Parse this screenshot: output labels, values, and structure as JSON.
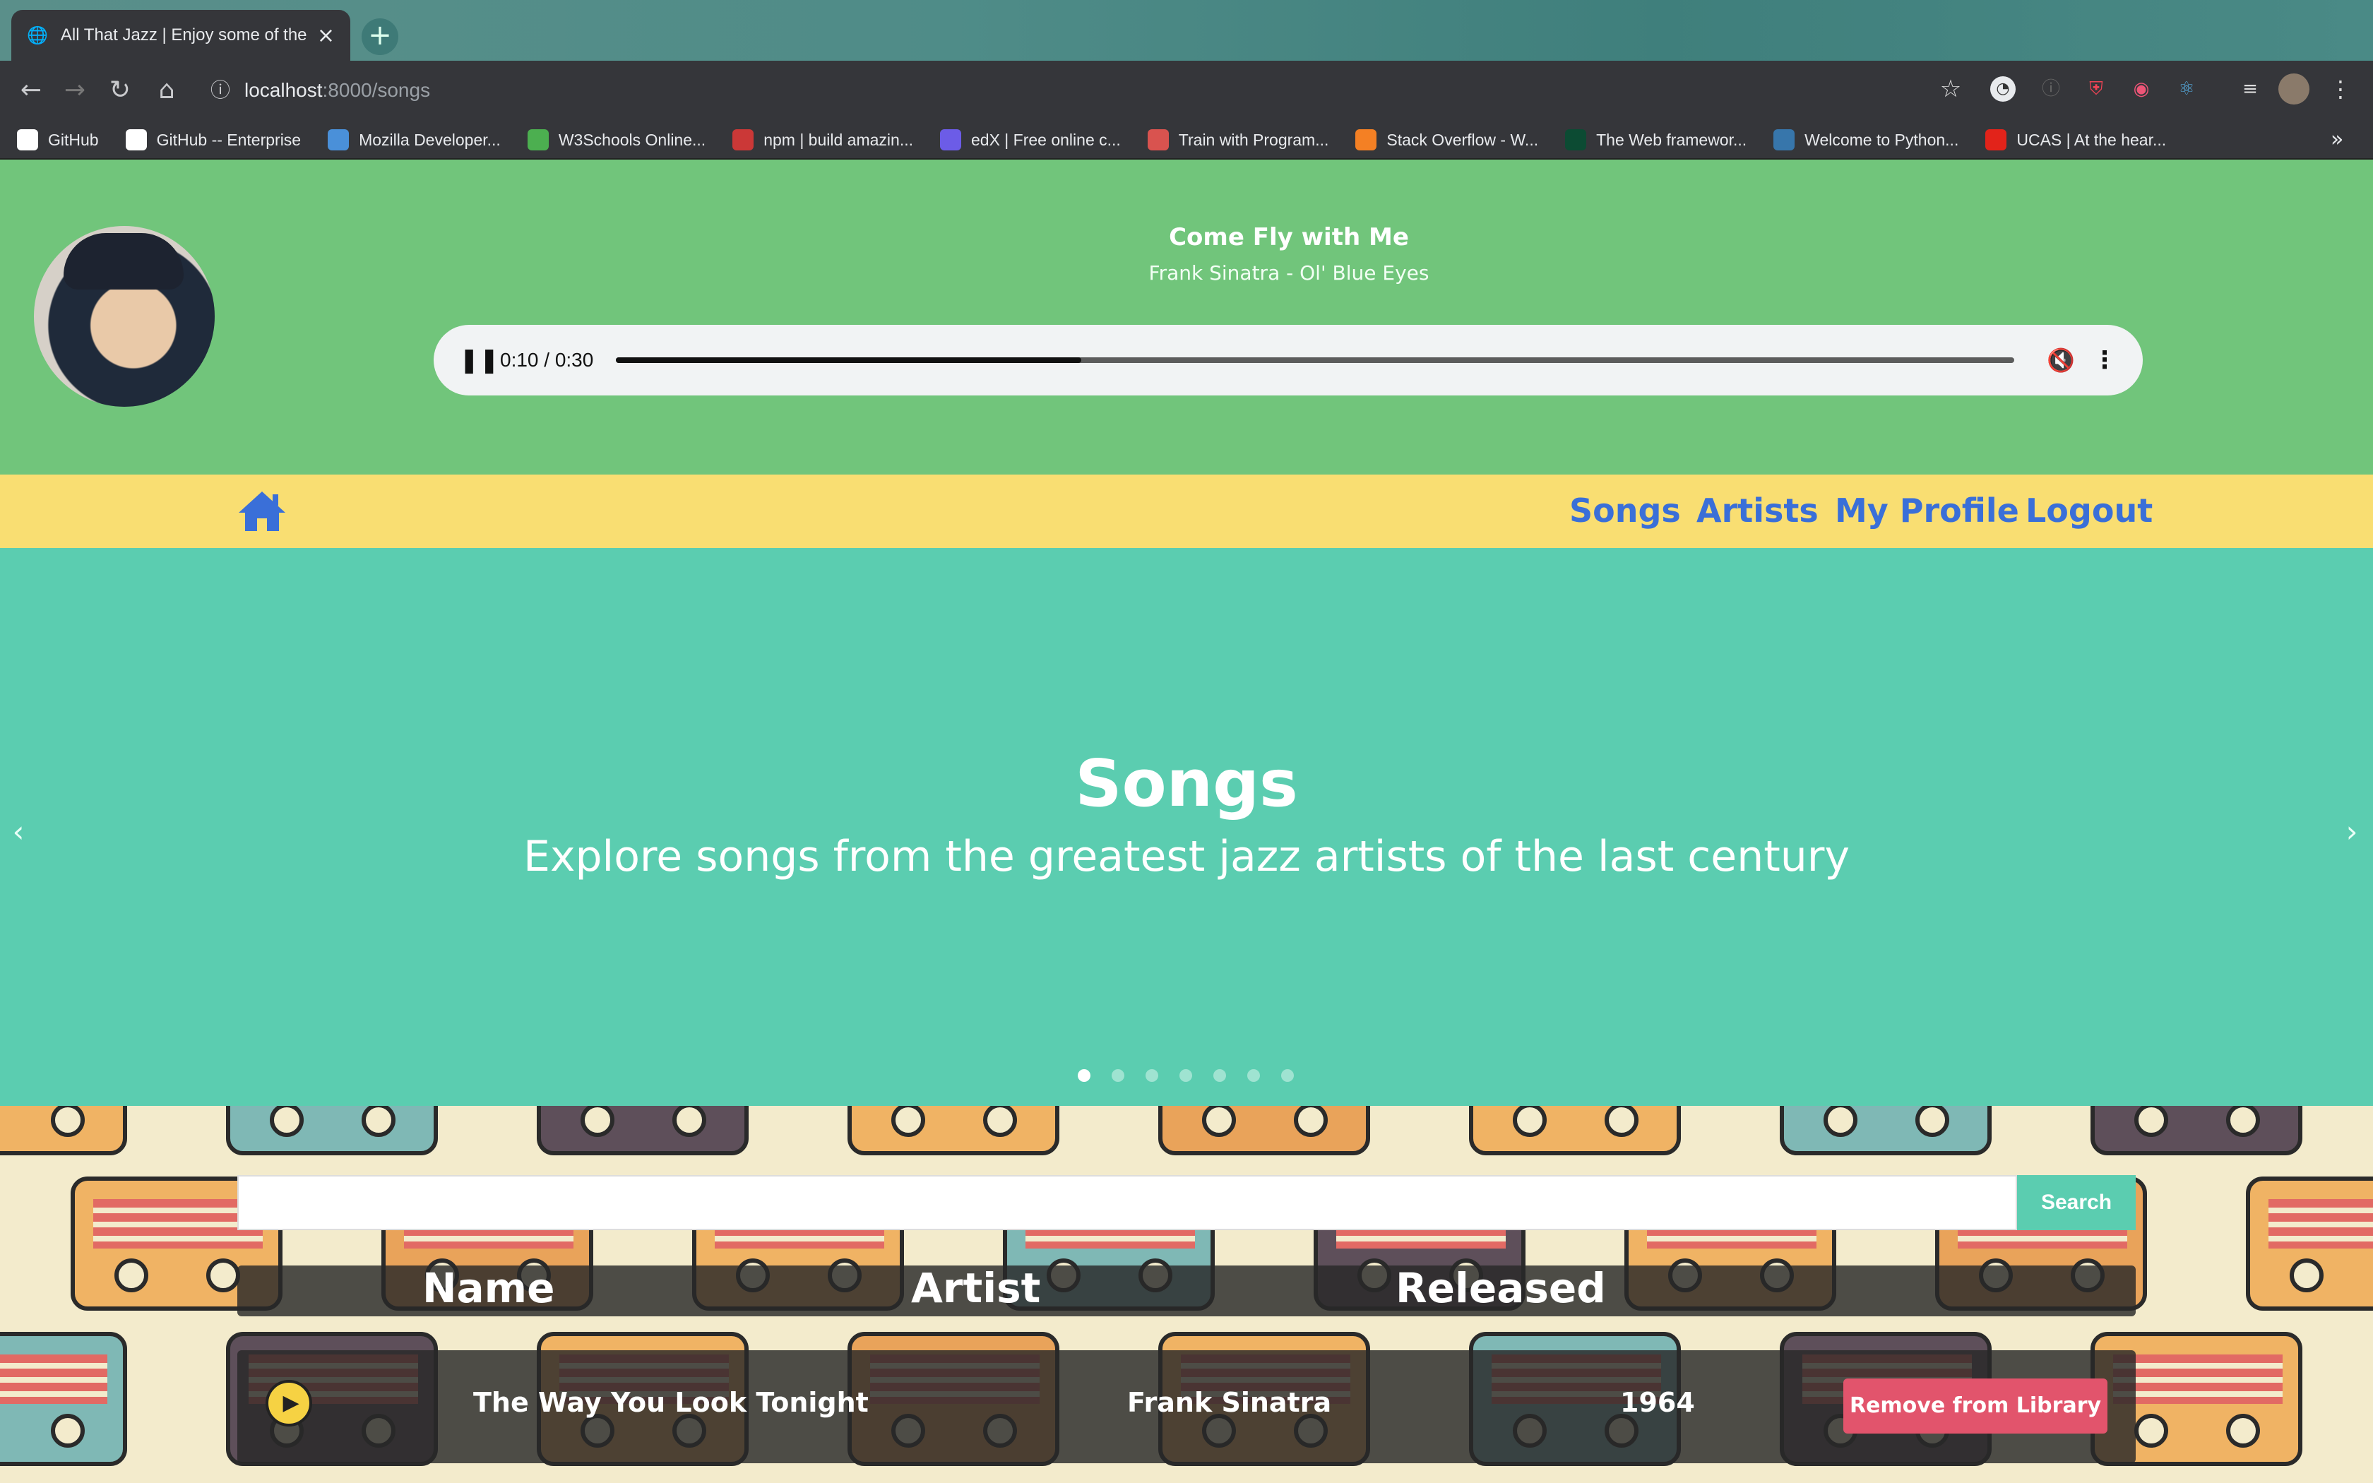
{
  "browser": {
    "tab_title": "All That Jazz | Enjoy some of the",
    "tab_close": "×",
    "new_tab": "+",
    "url_host": "localhost",
    "url_path": ":8000/songs",
    "bookmarks": [
      {
        "label": "GitHub",
        "icon": "github-icon",
        "color": "#ffffff"
      },
      {
        "label": "GitHub -- Enterprise",
        "icon": "github-icon",
        "color": "#ffffff"
      },
      {
        "label": "Mozilla Developer...",
        "icon": "mdn-icon",
        "color": "#4a90d9"
      },
      {
        "label": "W3Schools Online...",
        "icon": "w3schools-icon",
        "color": "#4caf50"
      },
      {
        "label": "npm | build amazin...",
        "icon": "npm-icon",
        "color": "#cb3837"
      },
      {
        "label": "edX | Free online c...",
        "icon": "edx-icon",
        "color": "#6c5ce7"
      },
      {
        "label": "Train with Program...",
        "icon": "program-icon",
        "color": "#d9534f"
      },
      {
        "label": "Stack Overflow - W...",
        "icon": "stackoverflow-icon",
        "color": "#f48024"
      },
      {
        "label": "The Web framewor...",
        "icon": "django-icon",
        "color": "#0c4b33"
      },
      {
        "label": "Welcome to Python...",
        "icon": "python-icon",
        "color": "#3776ab"
      },
      {
        "label": "UCAS | At the hear...",
        "icon": "ucas-icon",
        "color": "#e2231a"
      }
    ],
    "bookmarks_more": "»"
  },
  "player": {
    "title": "Come Fly with Me",
    "subtitle": "Frank Sinatra - Ol' Blue Eyes",
    "time": "0:10 / 0:30",
    "progress": 0.333
  },
  "nav": {
    "links": [
      "Songs",
      "Artists",
      "My Profile",
      "Logout"
    ]
  },
  "hero": {
    "title": "Songs",
    "subtitle": "Explore songs from the greatest jazz artists of the last century",
    "slides": 7,
    "active_slide": 0
  },
  "search": {
    "placeholder": "",
    "button": "Search"
  },
  "table": {
    "headers": [
      "Name",
      "Artist",
      "Released"
    ],
    "rows": [
      {
        "name": "The Way You Look Tonight",
        "artist": "Frank Sinatra",
        "released": "1964",
        "action": "Remove from Library"
      }
    ]
  },
  "colors": {
    "player_bg": "#71c57b",
    "nav_bg": "#f9de72",
    "hero_bg": "#5bcdb0",
    "link": "#3a6fd8",
    "remove_btn": "#e2546c"
  }
}
